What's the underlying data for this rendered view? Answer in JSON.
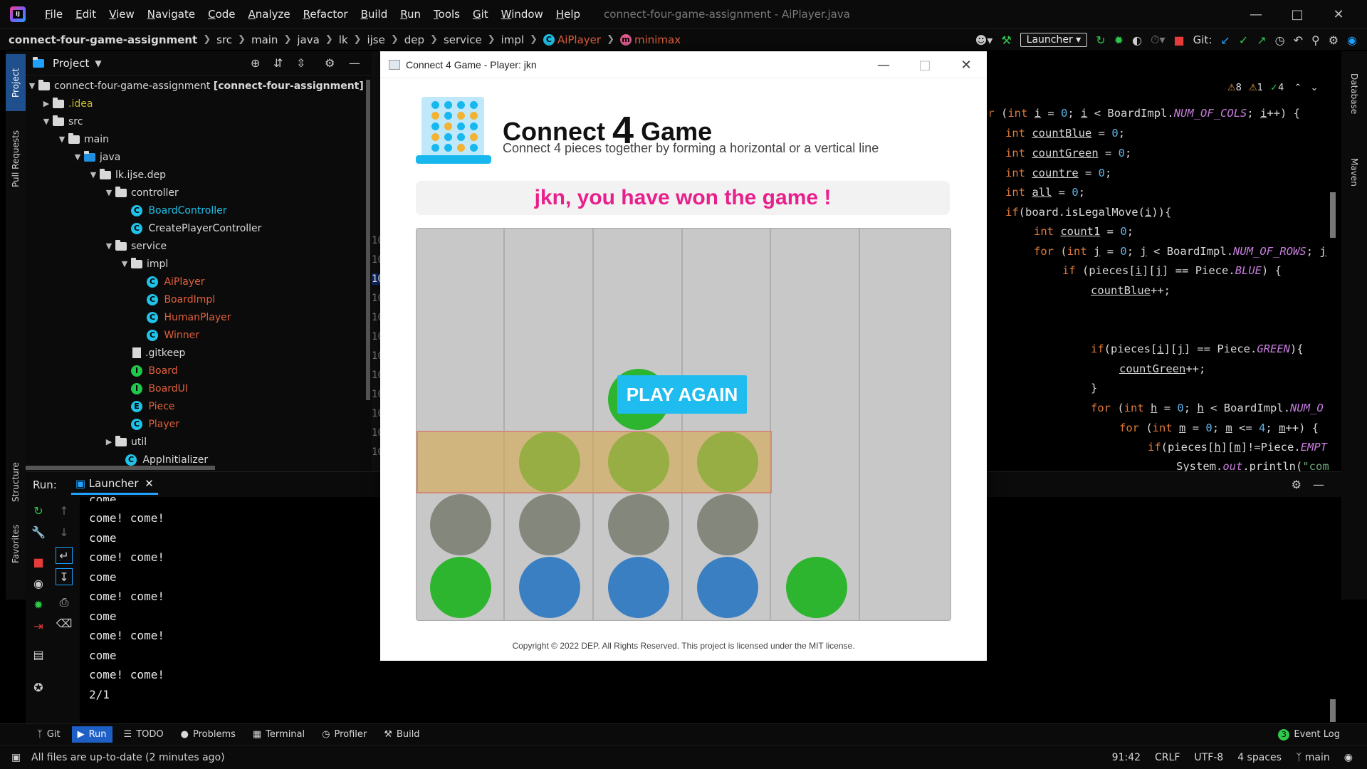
{
  "ide": {
    "menu": [
      "File",
      "Edit",
      "View",
      "Navigate",
      "Code",
      "Analyze",
      "Refactor",
      "Build",
      "Run",
      "Tools",
      "Git",
      "Window",
      "Help"
    ],
    "window_title": "connect-four-game-assignment - AiPlayer.java",
    "breadcrumb": [
      "connect-four-game-assignment",
      "src",
      "main",
      "java",
      "lk",
      "ijse",
      "dep",
      "service",
      "impl",
      "AiPlayer",
      "minimax"
    ],
    "run_config": "Launcher",
    "git_label": "Git:",
    "inspections": {
      "warnings": "8",
      "weak": "1",
      "ok": "4"
    }
  },
  "project": {
    "title": "Project",
    "tree": [
      {
        "label": "connect-four-game-assignment",
        "suffix": "[connect-four-assignment]"
      },
      {
        "label": ".idea"
      },
      {
        "label": "src"
      },
      {
        "label": "main"
      },
      {
        "label": "java"
      },
      {
        "label": "lk.ijse.dep"
      },
      {
        "label": "controller"
      },
      {
        "label": "BoardController"
      },
      {
        "label": "CreatePlayerController"
      },
      {
        "label": "service"
      },
      {
        "label": "impl"
      },
      {
        "label": "AiPlayer"
      },
      {
        "label": "BoardImpl"
      },
      {
        "label": "HumanPlayer"
      },
      {
        "label": "Winner"
      },
      {
        "label": ".gitkeep"
      },
      {
        "label": "Board"
      },
      {
        "label": "BoardUI"
      },
      {
        "label": "Piece"
      },
      {
        "label": "Player"
      },
      {
        "label": "util"
      },
      {
        "label": "AppInitializer"
      }
    ]
  },
  "editor": {
    "lines": [
      {
        "text": "or (int i = 0; i < BoardImpl.NUM_OF_COLS; i++) {"
      },
      {
        "text": "int countBlue = 0;"
      },
      {
        "text": "int countGreen = 0;"
      },
      {
        "text": "int countre = 0;"
      },
      {
        "text": "int all = 0;"
      },
      {
        "text": "if(board.isLegalMove(i)){"
      },
      {
        "text": "int count1 = 0;"
      },
      {
        "text": "for (int j = 0; j < BoardImpl.NUM_OF_ROWS; j"
      },
      {
        "text": "if (pieces[i][j] == Piece.BLUE) {"
      },
      {
        "text": "countBlue++;"
      },
      {
        "text": ""
      },
      {
        "text": ""
      },
      {
        "text": "if(pieces[i][j] == Piece.GREEN){"
      },
      {
        "text": "countGreen++;"
      },
      {
        "text": "}"
      },
      {
        "text": "for (int h = 0; h < BoardImpl.NUM_O"
      },
      {
        "text": "for (int m = 0; m <= 4; m++) {"
      },
      {
        "text": "if(pieces[h][m]!=Piece.EMPT"
      },
      {
        "text": "System.out.println(\"com"
      }
    ],
    "line_numbers": [
      "10",
      "10",
      "10",
      "10",
      "10",
      "10",
      "10",
      "10",
      "10",
      "10",
      "10",
      "10"
    ]
  },
  "run": {
    "label": "Run:",
    "tab": "Launcher",
    "console": [
      "come",
      "come! come!",
      "come",
      "come! come!",
      "come",
      "come! come!",
      "come",
      "come! come!",
      "come",
      "come! come!",
      "2/1"
    ]
  },
  "bottom_tabs": [
    "Git",
    "Run",
    "TODO",
    "Problems",
    "Terminal",
    "Profiler",
    "Build"
  ],
  "event_log": "Event Log",
  "event_count": "3",
  "status": {
    "message": "All files are up-to-date (2 minutes ago)",
    "position": "91:42",
    "line_sep": "CRLF",
    "encoding": "UTF-8",
    "indent": "4 spaces",
    "branch": "main"
  },
  "side_tabs": {
    "left": [
      "Project",
      "Pull Requests",
      "Structure",
      "Favorites"
    ],
    "right": [
      "Database",
      "Maven"
    ]
  },
  "game": {
    "window_title": "Connect 4 Game - Player: jkn",
    "title_pre": "Connect",
    "title_num": "4",
    "title_post": "Game",
    "subtitle": "Connect 4 pieces together by forming a horizontal or a vertical line",
    "message": "jkn, you have won the game !",
    "play_again": "PLAY AGAIN",
    "copyright": "Copyright © 2022 DEP. All Rights Reserved. This project is licensed under the MIT license.",
    "board": {
      "columns": 6,
      "rows": 5,
      "cells_bottom_up": [
        [
          "green",
          "won"
        ],
        [
          "blue",
          "won",
          "green"
        ],
        [
          "blue",
          "won",
          "green",
          "green"
        ],
        [
          "blue",
          "won",
          "green"
        ],
        [
          "green"
        ],
        []
      ],
      "winning_row": 2
    },
    "colors": {
      "green": "#2db52f",
      "blue": "#3b7fc3",
      "message": "#e8208c",
      "button": "#1fbcf0"
    }
  }
}
